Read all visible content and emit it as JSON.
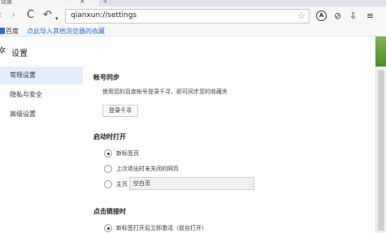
{
  "browser": {
    "tab_title": "设置",
    "tab_close": "×",
    "new_tab": "+",
    "url": "qianxun://settings",
    "icons": [
      "back-icon",
      "forward-icon",
      "reload-icon",
      "undo-icon",
      "star-icon",
      "adblock-icon",
      "compass-icon",
      "download-icon",
      "menu-icon"
    ],
    "glyphs": {
      "back": "‹",
      "forward": "›",
      "reload": "C",
      "undo": "↶",
      "caret": "▾",
      "star": "☆",
      "adblock": "A",
      "compass": "⊘",
      "download": "⇩",
      "menu": "≡"
    }
  },
  "bookmarks": {
    "first": "百度",
    "import_link": "点此导入其他浏览器的收藏"
  },
  "header": {
    "title": "设置",
    "gear_glyph": "✲"
  },
  "sidebar": {
    "items": [
      {
        "label": "常规设置",
        "active": true
      },
      {
        "label": "隐私与安全",
        "active": false
      },
      {
        "label": "高级设置",
        "active": false
      }
    ]
  },
  "account": {
    "title": "帐号同步",
    "description": "使用您的百度帐号登录千寻，即可同步您的收藏夹",
    "login_button": "登录千寻"
  },
  "startup": {
    "title": "启动时打开",
    "options": [
      {
        "label": "新标签页",
        "checked": true
      },
      {
        "label": "上次退出时未关闭的网页",
        "checked": false
      },
      {
        "label": "主页",
        "checked": false
      }
    ],
    "home_value": "空白页"
  },
  "link_click": {
    "title": "点击链接时",
    "options": [
      {
        "label": "新标签打开后立即激活（前台打开）",
        "checked": true
      }
    ]
  },
  "colors": {
    "accent": "#2a6dd0",
    "active_bg": "#e6ecf9"
  }
}
